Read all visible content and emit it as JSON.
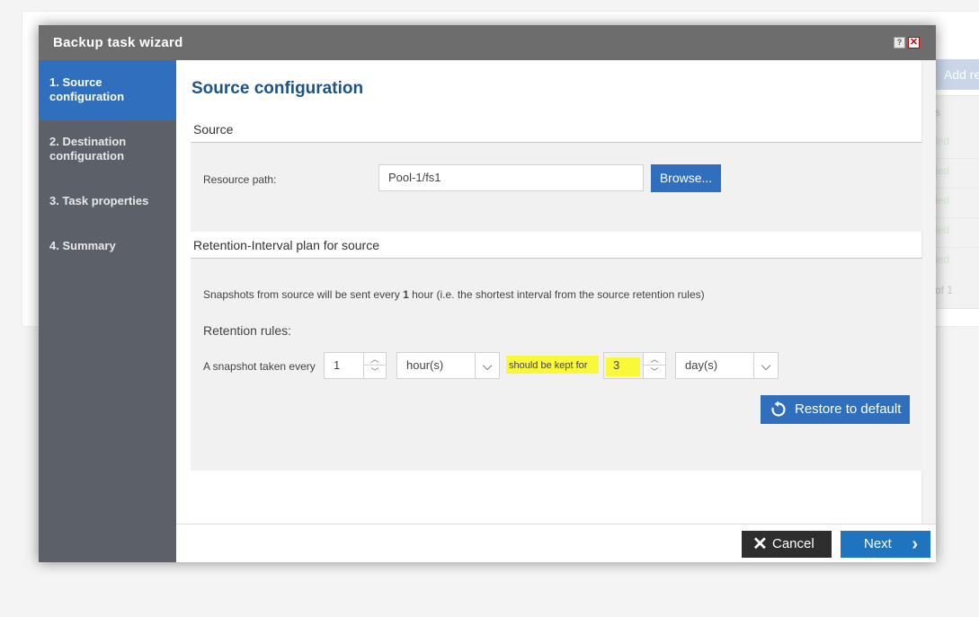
{
  "background": {
    "add_button_label": "Add re",
    "column_header": "s",
    "statuses": [
      "led",
      "led",
      "led",
      "led",
      "led"
    ],
    "pagination": "of 1"
  },
  "dialog": {
    "title": "Backup task wizard",
    "help_label": "?",
    "close_label": "✕"
  },
  "steps": [
    {
      "label_line1": "1. Source",
      "label_line2": "configuration"
    },
    {
      "label_line1": "2. Destination",
      "label_line2": "configuration"
    },
    {
      "label_line1": "3. Task properties",
      "label_line2": ""
    },
    {
      "label_line1": "4. Summary",
      "label_line2": ""
    }
  ],
  "main": {
    "heading": "Source configuration",
    "source": {
      "section_title": "Source",
      "resource_path_label": "Resource path:",
      "resource_path_value": "Pool-1/fs1",
      "browse_label": "Browse..."
    },
    "retention": {
      "section_title": "Retention-Interval plan for source",
      "info_prefix": "Snapshots from source will be sent every ",
      "info_bold": "1",
      "info_suffix": " hour (i.e. the shortest interval from the source retention rules)",
      "rules_label": "Retention rules:",
      "snapshot_taken_label": "A snapshot taken every",
      "interval_value": "1",
      "interval_unit": "hour(s)",
      "kept_for_label": "should be kept for",
      "kept_value": "3",
      "kept_unit": "day(s)",
      "restore_label": "Restore to default"
    }
  },
  "footer": {
    "cancel_label": "Cancel",
    "next_label": "Next"
  },
  "colors": {
    "accent": "#2f6fbd",
    "highlight": "#f9f93a",
    "sidebar": "#5c6068",
    "titlebar": "#6d6d6d"
  }
}
